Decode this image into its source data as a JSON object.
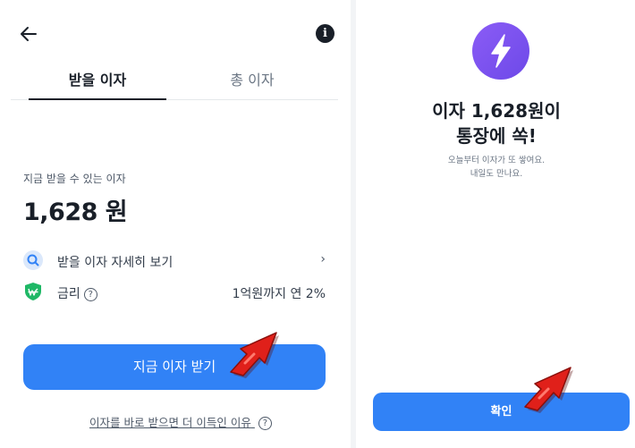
{
  "left": {
    "tabs": [
      {
        "label": "받을 이자"
      },
      {
        "label": "총 이자"
      }
    ],
    "info_icon_glyph": "i",
    "sub_label": "지금 받을 수 있는 이자",
    "amount": "1,628 원",
    "detail_row": {
      "label": "받을 이자 자세히 보기",
      "chevron": "›"
    },
    "rate_row": {
      "label": "금리",
      "help": "?",
      "value": "1억원까지 연 2%"
    },
    "primary_button": "지금 이자 받기",
    "link": {
      "text": "이자를 바로 받으면 더 이득인 이유",
      "help": "?"
    }
  },
  "right": {
    "headline_1": "이자 1,628원이",
    "headline_2": "통장에 쏙!",
    "message_1": "오늘부터 이자가 또 쌓여요.",
    "message_2": "내일도 만나요.",
    "confirm_button": "확인"
  },
  "icons": {
    "back": "back-arrow-icon",
    "info": "info-icon",
    "search": "search-icon",
    "rate": "won-shield-icon",
    "bolt": "lightning-bolt-icon",
    "annotation": "red-arrow-icon"
  },
  "colors": {
    "accent": "#3182f6",
    "bolt_badge": "#7c55f0",
    "shield": "#1fb866",
    "annotation_arrow": "#e0201a"
  }
}
